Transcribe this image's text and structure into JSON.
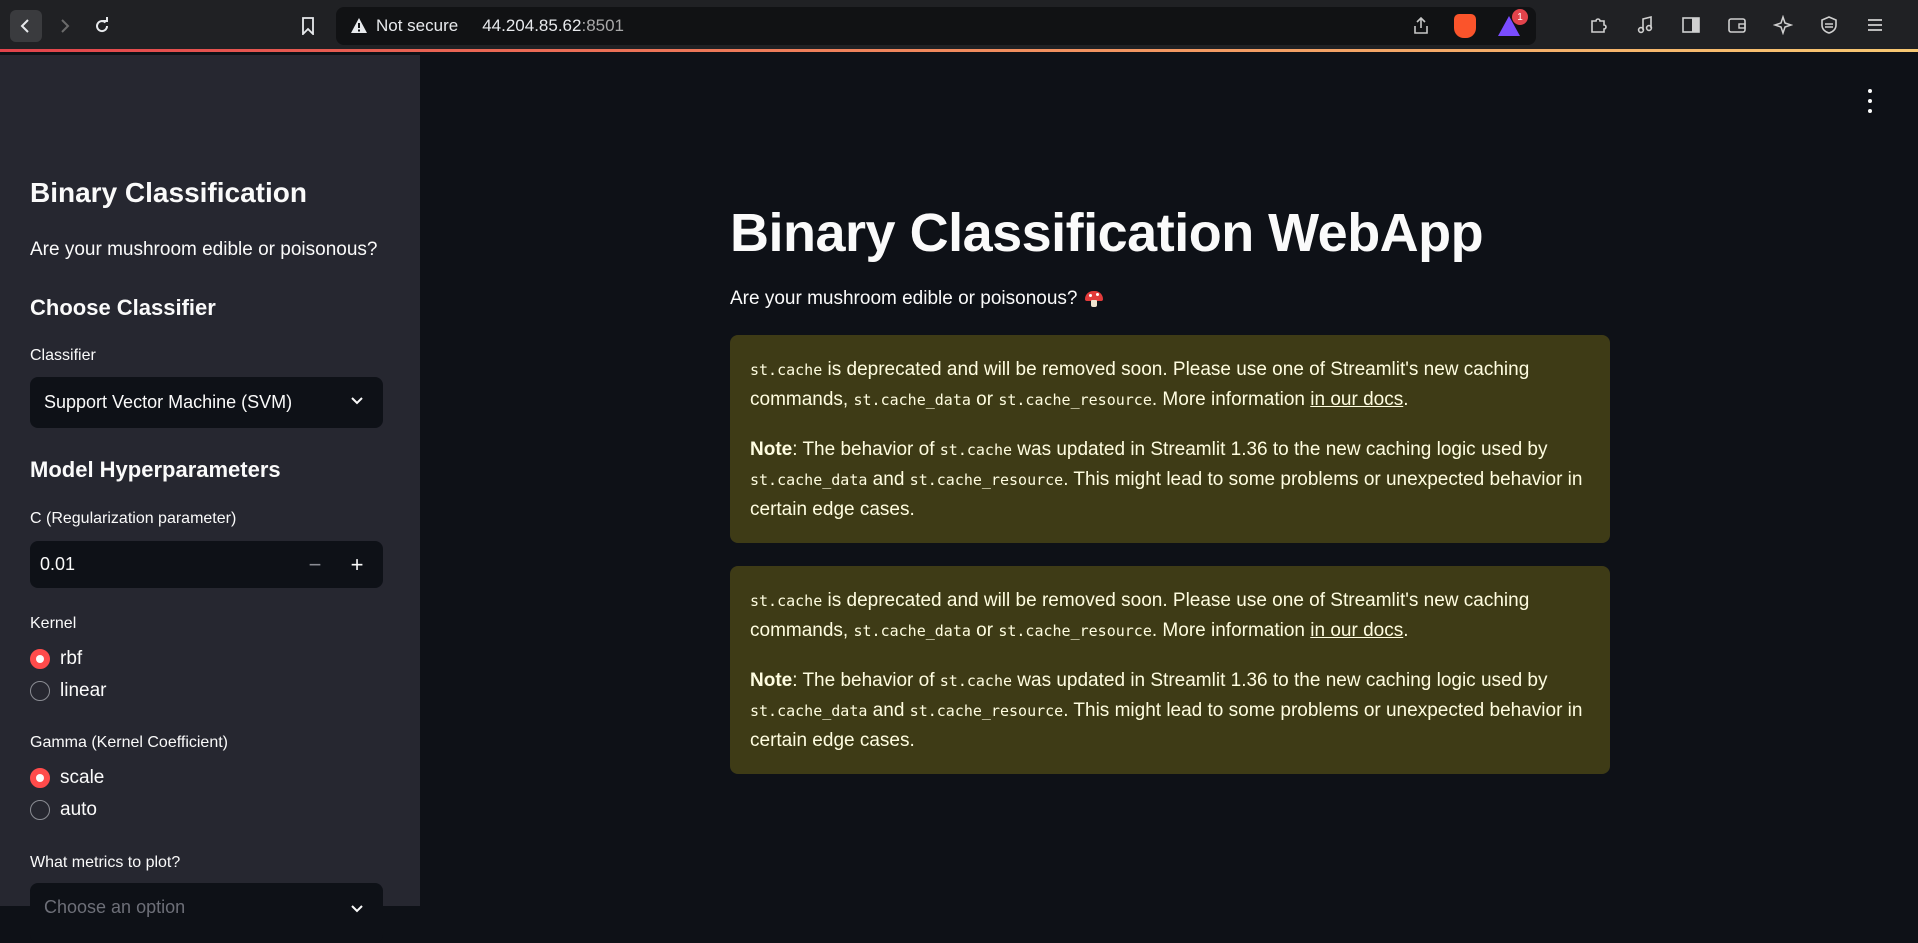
{
  "browser": {
    "not_secure_label": "Not secure",
    "url_host": "44.204.85.62",
    "url_port": ":8501",
    "rewards_badge": "1",
    "accent_colors": [
      "#e2434b",
      "#f08a5d",
      "#f7c873"
    ]
  },
  "sidebar": {
    "title": "Binary Classification",
    "subtitle": "Are your mushroom edible or poisonous?",
    "choose_classifier_heading": "Choose Classifier",
    "classifier_label": "Classifier",
    "classifier_value": "Support Vector Machine (SVM)",
    "hyperparams_heading": "Model Hyperparameters",
    "c_label": "C (Regularization parameter)",
    "c_value": "0.01",
    "minus_label": "−",
    "plus_label": "+",
    "kernel_label": "Kernel",
    "kernel_options": [
      {
        "label": "rbf",
        "selected": true
      },
      {
        "label": "linear",
        "selected": false
      }
    ],
    "gamma_label": "Gamma (Kernel Coefficient)",
    "gamma_options": [
      {
        "label": "scale",
        "selected": true
      },
      {
        "label": "auto",
        "selected": false
      }
    ],
    "metrics_label": "What metrics to plot?",
    "metrics_placeholder": "Choose an option"
  },
  "main": {
    "title": "Binary Classification WebApp",
    "subtitle": "Are your mushroom edible or poisonous?",
    "warnings": [
      {
        "code1": "st.cache",
        "text1": " is deprecated and will be removed soon. Please use one of Streamlit's new caching commands, ",
        "code2": "st.cache_data",
        "text2": " or ",
        "code3": "st.cache_resource",
        "text3": ". More information ",
        "link": "in our docs",
        "text4": ".",
        "note_label": "Note",
        "note_text1": ": The behavior of ",
        "note_code1": "st.cache",
        "note_text2": " was updated in Streamlit 1.36 to the new caching logic used by ",
        "note_code2": "st.cache_data",
        "note_text3": " and ",
        "note_code3": "st.cache_resource",
        "note_text4": ". This might lead to some problems or unexpected behavior in certain edge cases."
      },
      {
        "code1": "st.cache",
        "text1": " is deprecated and will be removed soon. Please use one of Streamlit's new caching commands, ",
        "code2": "st.cache_data",
        "text2": " or ",
        "code3": "st.cache_resource",
        "text3": ". More information ",
        "link": "in our docs",
        "text4": ".",
        "note_label": "Note",
        "note_text1": ": The behavior of ",
        "note_code1": "st.cache",
        "note_text2": " was updated in Streamlit 1.36 to the new caching logic used by ",
        "note_code2": "st.cache_data",
        "note_text3": " and ",
        "note_code3": "st.cache_resource",
        "note_text4": ". This might lead to some problems or unexpected behavior in certain edge cases."
      }
    ]
  },
  "colors": {
    "accent_red": "#ff4b4b",
    "sidebar_bg": "#262730",
    "main_bg": "#0e1117",
    "warning_bg": "#3e3b16",
    "warning_text": "#fffde0"
  }
}
